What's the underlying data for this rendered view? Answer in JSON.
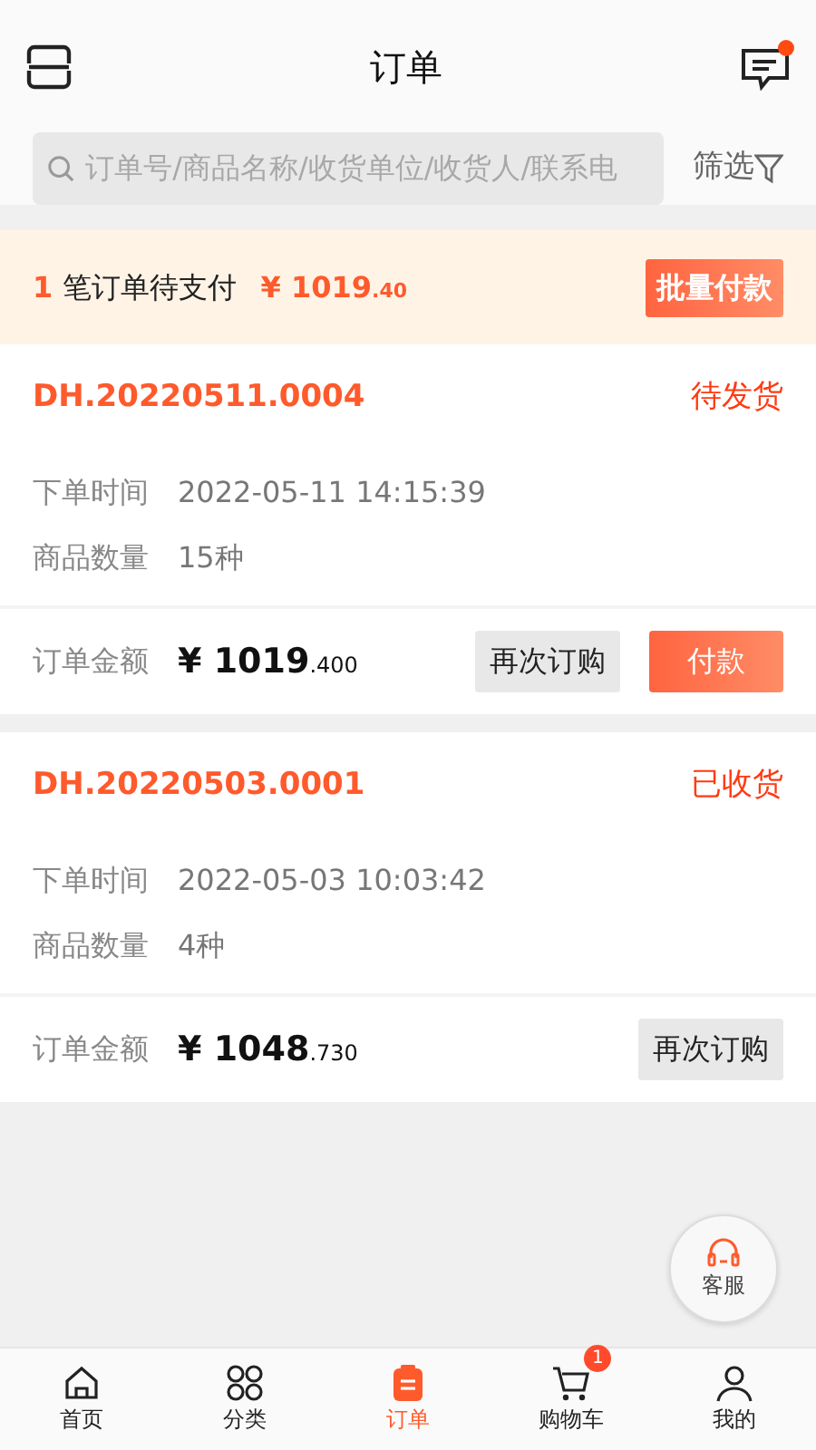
{
  "header": {
    "title": "订单",
    "has_unread": true
  },
  "search": {
    "placeholder": "订单号/商品名称/收货单位/收货人/联系电",
    "filter_label": "筛选"
  },
  "pending_banner": {
    "count": "1",
    "text": "笔订单待支付",
    "currency": "¥",
    "amount": "1019",
    "decimals": ".40",
    "button": "批量付款"
  },
  "orders": [
    {
      "number": "DH.20220511.0004",
      "status": "待发货",
      "fields": [
        {
          "label": "下单时间",
          "value": "2022-05-11 14:15:39"
        },
        {
          "label": "商品数量",
          "value": "15种"
        }
      ],
      "amount_label": "订单金额",
      "currency": "¥",
      "amount": "1019",
      "decimals": ".400",
      "buttons": [
        {
          "label": "再次订购",
          "kind": "secondary"
        },
        {
          "label": "付款",
          "kind": "primary"
        }
      ]
    },
    {
      "number": "DH.20220503.0001",
      "status": "已收货",
      "fields": [
        {
          "label": "下单时间",
          "value": "2022-05-03 10:03:42"
        },
        {
          "label": "商品数量",
          "value": "4种"
        }
      ],
      "amount_label": "订单金额",
      "currency": "¥",
      "amount": "1048",
      "decimals": ".730",
      "buttons": [
        {
          "label": "再次订购",
          "kind": "secondary"
        }
      ]
    }
  ],
  "service_button": "客服",
  "tabs": [
    {
      "label": "首页",
      "selected": false
    },
    {
      "label": "分类",
      "selected": false
    },
    {
      "label": "订单",
      "selected": true
    },
    {
      "label": "购物车",
      "selected": false,
      "badge": "1"
    },
    {
      "label": "我的",
      "selected": false
    }
  ]
}
